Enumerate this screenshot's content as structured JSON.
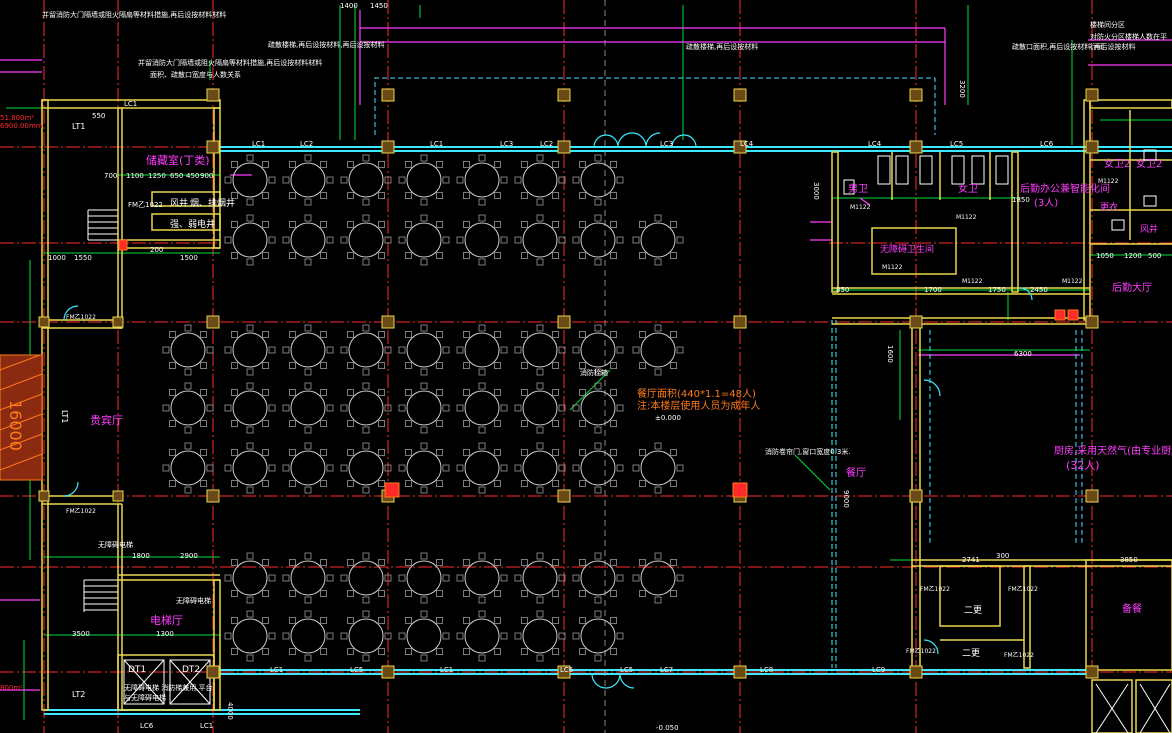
{
  "rooms": {
    "storage_tea": "储藏室(丁类)",
    "wind_shaft": "风井",
    "smoke_shaft": "烟、排烟井",
    "strong_weak_shaft": "强、弱电井",
    "vip_hall": "贵宾厅",
    "elevator_hall": "电梯厅",
    "male_wc": "男卫",
    "female_wc": "女卫",
    "accessible_wc": "无障碍卫生间",
    "back_office": "后勤办公兼智能化间",
    "back_office_cap": "(3人)",
    "female_wc2": "女卫2",
    "female_wc2b": "女卫2",
    "changing": "更衣",
    "wind": "风井",
    "back_hall": "后勤大厅",
    "corridor": "走道",
    "kitchen": "厨房,采用天然气(由专业厨房厂家",
    "kitchen_cap": "(32人)",
    "secondary_change1": "二更",
    "secondary_change2": "二更",
    "storage": "备餐",
    "dining_note1": "餐厅面积(440*1.1=48人)",
    "dining_note2": "注:本楼层使用人员为成年人",
    "fire_note": "消防卷帘门,窗口宽度0.3米.",
    "elev_note": "无障碍电梯 消防梯兼用,平台与无障碍电梯",
    "fire_label": "消防栓箱",
    "dining_label": "餐厅",
    "evac_label": "疏散",
    "lt1": "LT1",
    "lt2": "LT2",
    "lt3": "LT1",
    "dt1": "DT1",
    "dt2": "DT2",
    "area_1": "51.800m²",
    "area_2": "6900.00mm",
    "area_3": "800m²",
    "level_1": "±0.000",
    "level_2": "-0.050",
    "note_top1": "并留消防大门隔墙或阻火隔扇等材料措施,再后设按材料材料",
    "note_top2": "并留消防大门隔墙或阻火隔扇等材料措施,再后设按材料材料",
    "note_top3": "面积、疏散口宽度与人数关系",
    "note_top4": "疏散口面积,再后设按材料,再后设按材料",
    "note_right1": "楼梯间分区",
    "note_right2": "对防火分区楼梯人数在平行间",
    "note_mid": "疏散楼梯,再后设按材料,再后设按材料",
    "note_mid2": "疏散楼梯,再后设按材料",
    "elev_label": "无障碍电梯",
    "elev_label2": "无障碍电梯",
    "fw_door": "FM乙1022",
    "tower_text": "16000"
  },
  "dims": {
    "d_550": "550",
    "d_1400": "1400",
    "d_1450": "1450",
    "d_700": "700",
    "d_1100": "1100",
    "d_1250": "1250",
    "d_650": "650",
    "d_450": "450",
    "d_900": "900",
    "d_1000": "1000",
    "d_1550": "1550",
    "d_1500": "1500",
    "d_200": "200",
    "d_1800": "1800",
    "d_2900": "2900",
    "d_3500": "3500",
    "d_1300": "1300",
    "d_3000": "3000",
    "d_2450": "2450",
    "d_1750": "1750",
    "d_1700": "1700",
    "d_6300": "6300",
    "d_3850": "3850",
    "d_2741": "2741",
    "d_3200": "3200",
    "d_1600": "1600",
    "d_9000": "9000",
    "d_850": "850",
    "d_1050": "1050",
    "d_1200": "1200",
    "d_500": "500",
    "d_4000": "4000",
    "d_300": "300",
    "d_1850": "1850"
  },
  "window_tags": [
    "LC1",
    "LC1",
    "LC2",
    "LC1",
    "LC3",
    "LC2",
    "LC3",
    "LC4",
    "LC4",
    "LC5",
    "LC6",
    "LC6",
    "LC5",
    "LC7",
    "LC8",
    "LC9",
    "LC1",
    "LC5",
    "LC1",
    "LC6",
    "LC1"
  ],
  "door_tags": [
    "M1122",
    "M1122",
    "M1122",
    "M1122",
    "M1122",
    "M1122",
    "FM乙1022",
    "FM乙1022",
    "FM乙1022",
    "FM乙1022",
    "FM乙1022",
    "FM乙1022"
  ],
  "colors": {
    "wall": "#e8d84a",
    "axis": "#ff2a2a",
    "dim": "#00e03a",
    "magenta": "#ff3cff",
    "cyan": "#3ce8ff",
    "column": "#d8a640",
    "table": "#cfcfcf",
    "text": "#ffffff",
    "blue": "#3a6cff",
    "orange": "#ff7a1a"
  }
}
